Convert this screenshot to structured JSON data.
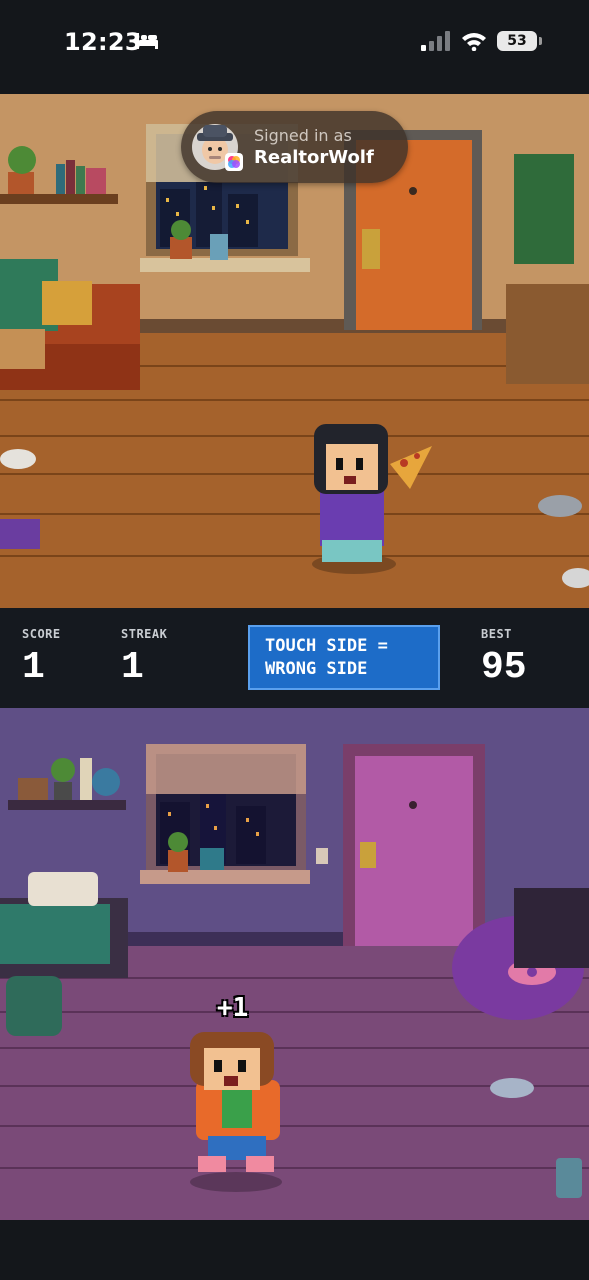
{
  "status_bar": {
    "time": "12:23",
    "battery": "53"
  },
  "toast": {
    "line1": "Signed in as",
    "username": "RealtorWolf"
  },
  "hud": {
    "score_label": "SCORE",
    "score_value": "1",
    "streak_label": "STREAK",
    "streak_value": "1",
    "hint_line1": "TOUCH SIDE =",
    "hint_line2": "WRONG SIDE",
    "best_label": "BEST",
    "best_value": "95"
  },
  "popup": {
    "text": "+1"
  },
  "colors": {
    "hint_bg": "#1d6cc8",
    "hud_bg": "#15191f",
    "top_room": "#b07f4f",
    "bottom_room": "#5a3d70"
  },
  "icons": [
    "sleep-bed-icon",
    "cellular-signal-icon",
    "wifi-icon",
    "battery-icon",
    "game-center-icon"
  ]
}
